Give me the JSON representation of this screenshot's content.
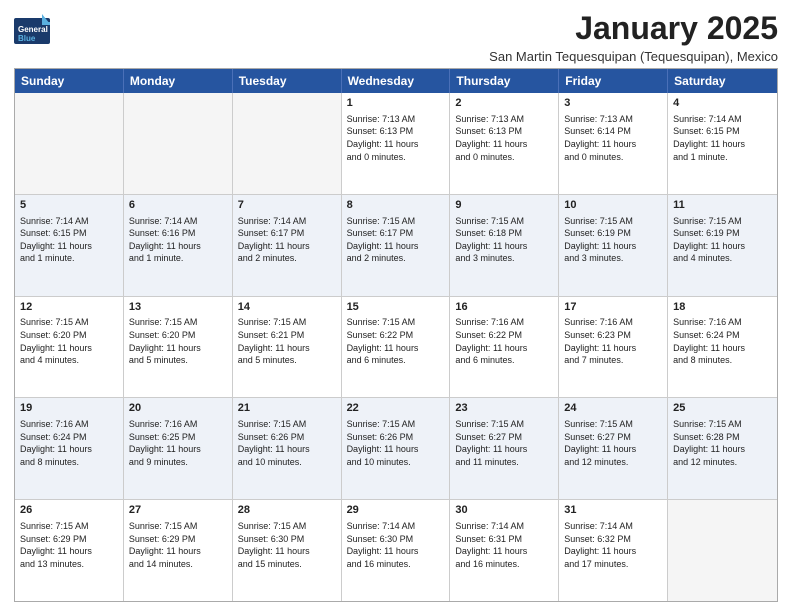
{
  "header": {
    "logo_general": "General",
    "logo_blue": "Blue",
    "title": "January 2025",
    "subtitle": "San Martin Tequesquipan (Tequesquipan), Mexico"
  },
  "calendar": {
    "days": [
      "Sunday",
      "Monday",
      "Tuesday",
      "Wednesday",
      "Thursday",
      "Friday",
      "Saturday"
    ],
    "rows": [
      [
        {
          "day": "",
          "info": ""
        },
        {
          "day": "",
          "info": ""
        },
        {
          "day": "",
          "info": ""
        },
        {
          "day": "1",
          "info": "Sunrise: 7:13 AM\nSunset: 6:13 PM\nDaylight: 11 hours\nand 0 minutes."
        },
        {
          "day": "2",
          "info": "Sunrise: 7:13 AM\nSunset: 6:13 PM\nDaylight: 11 hours\nand 0 minutes."
        },
        {
          "day": "3",
          "info": "Sunrise: 7:13 AM\nSunset: 6:14 PM\nDaylight: 11 hours\nand 0 minutes."
        },
        {
          "day": "4",
          "info": "Sunrise: 7:14 AM\nSunset: 6:15 PM\nDaylight: 11 hours\nand 1 minute."
        }
      ],
      [
        {
          "day": "5",
          "info": "Sunrise: 7:14 AM\nSunset: 6:15 PM\nDaylight: 11 hours\nand 1 minute."
        },
        {
          "day": "6",
          "info": "Sunrise: 7:14 AM\nSunset: 6:16 PM\nDaylight: 11 hours\nand 1 minute."
        },
        {
          "day": "7",
          "info": "Sunrise: 7:14 AM\nSunset: 6:17 PM\nDaylight: 11 hours\nand 2 minutes."
        },
        {
          "day": "8",
          "info": "Sunrise: 7:15 AM\nSunset: 6:17 PM\nDaylight: 11 hours\nand 2 minutes."
        },
        {
          "day": "9",
          "info": "Sunrise: 7:15 AM\nSunset: 6:18 PM\nDaylight: 11 hours\nand 3 minutes."
        },
        {
          "day": "10",
          "info": "Sunrise: 7:15 AM\nSunset: 6:19 PM\nDaylight: 11 hours\nand 3 minutes."
        },
        {
          "day": "11",
          "info": "Sunrise: 7:15 AM\nSunset: 6:19 PM\nDaylight: 11 hours\nand 4 minutes."
        }
      ],
      [
        {
          "day": "12",
          "info": "Sunrise: 7:15 AM\nSunset: 6:20 PM\nDaylight: 11 hours\nand 4 minutes."
        },
        {
          "day": "13",
          "info": "Sunrise: 7:15 AM\nSunset: 6:20 PM\nDaylight: 11 hours\nand 5 minutes."
        },
        {
          "day": "14",
          "info": "Sunrise: 7:15 AM\nSunset: 6:21 PM\nDaylight: 11 hours\nand 5 minutes."
        },
        {
          "day": "15",
          "info": "Sunrise: 7:15 AM\nSunset: 6:22 PM\nDaylight: 11 hours\nand 6 minutes."
        },
        {
          "day": "16",
          "info": "Sunrise: 7:16 AM\nSunset: 6:22 PM\nDaylight: 11 hours\nand 6 minutes."
        },
        {
          "day": "17",
          "info": "Sunrise: 7:16 AM\nSunset: 6:23 PM\nDaylight: 11 hours\nand 7 minutes."
        },
        {
          "day": "18",
          "info": "Sunrise: 7:16 AM\nSunset: 6:24 PM\nDaylight: 11 hours\nand 8 minutes."
        }
      ],
      [
        {
          "day": "19",
          "info": "Sunrise: 7:16 AM\nSunset: 6:24 PM\nDaylight: 11 hours\nand 8 minutes."
        },
        {
          "day": "20",
          "info": "Sunrise: 7:16 AM\nSunset: 6:25 PM\nDaylight: 11 hours\nand 9 minutes."
        },
        {
          "day": "21",
          "info": "Sunrise: 7:15 AM\nSunset: 6:26 PM\nDaylight: 11 hours\nand 10 minutes."
        },
        {
          "day": "22",
          "info": "Sunrise: 7:15 AM\nSunset: 6:26 PM\nDaylight: 11 hours\nand 10 minutes."
        },
        {
          "day": "23",
          "info": "Sunrise: 7:15 AM\nSunset: 6:27 PM\nDaylight: 11 hours\nand 11 minutes."
        },
        {
          "day": "24",
          "info": "Sunrise: 7:15 AM\nSunset: 6:27 PM\nDaylight: 11 hours\nand 12 minutes."
        },
        {
          "day": "25",
          "info": "Sunrise: 7:15 AM\nSunset: 6:28 PM\nDaylight: 11 hours\nand 12 minutes."
        }
      ],
      [
        {
          "day": "26",
          "info": "Sunrise: 7:15 AM\nSunset: 6:29 PM\nDaylight: 11 hours\nand 13 minutes."
        },
        {
          "day": "27",
          "info": "Sunrise: 7:15 AM\nSunset: 6:29 PM\nDaylight: 11 hours\nand 14 minutes."
        },
        {
          "day": "28",
          "info": "Sunrise: 7:15 AM\nSunset: 6:30 PM\nDaylight: 11 hours\nand 15 minutes."
        },
        {
          "day": "29",
          "info": "Sunrise: 7:14 AM\nSunset: 6:30 PM\nDaylight: 11 hours\nand 16 minutes."
        },
        {
          "day": "30",
          "info": "Sunrise: 7:14 AM\nSunset: 6:31 PM\nDaylight: 11 hours\nand 16 minutes."
        },
        {
          "day": "31",
          "info": "Sunrise: 7:14 AM\nSunset: 6:32 PM\nDaylight: 11 hours\nand 17 minutes."
        },
        {
          "day": "",
          "info": ""
        }
      ]
    ]
  }
}
